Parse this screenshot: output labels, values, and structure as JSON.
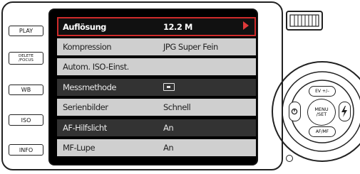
{
  "left_buttons": [
    {
      "label": "PLAY"
    },
    {
      "label_line1": "DELETE",
      "label_line2": "/FOCUS"
    },
    {
      "label": "WB"
    },
    {
      "label": "ISO"
    },
    {
      "label": "INFO"
    }
  ],
  "menu": {
    "rows": [
      {
        "label": "Auflösung",
        "value": "12.2 M",
        "state": "selected"
      },
      {
        "label": "Kompression",
        "value": "JPG Super Fein",
        "state": "light"
      },
      {
        "label": "Autom. ISO-Einst.",
        "value": "",
        "state": "light"
      },
      {
        "label": "Messmethode",
        "value": "",
        "icon": "spot-metering-icon",
        "state": "dark"
      },
      {
        "label": "Serienbilder",
        "value": "Schnell",
        "state": "light"
      },
      {
        "label": "AF-Hilfslicht",
        "value": "An",
        "state": "dark"
      },
      {
        "label": "MF-Lupe",
        "value": "An",
        "state": "light"
      }
    ],
    "selected_border_color": "#cf2b2b"
  },
  "control_pad": {
    "center_line1": "MENU",
    "center_line2": "/SET",
    "up": "EV +/–",
    "down": "AF/MF",
    "left_icon": "self-timer-icon",
    "right_icon": "flash-icon"
  }
}
